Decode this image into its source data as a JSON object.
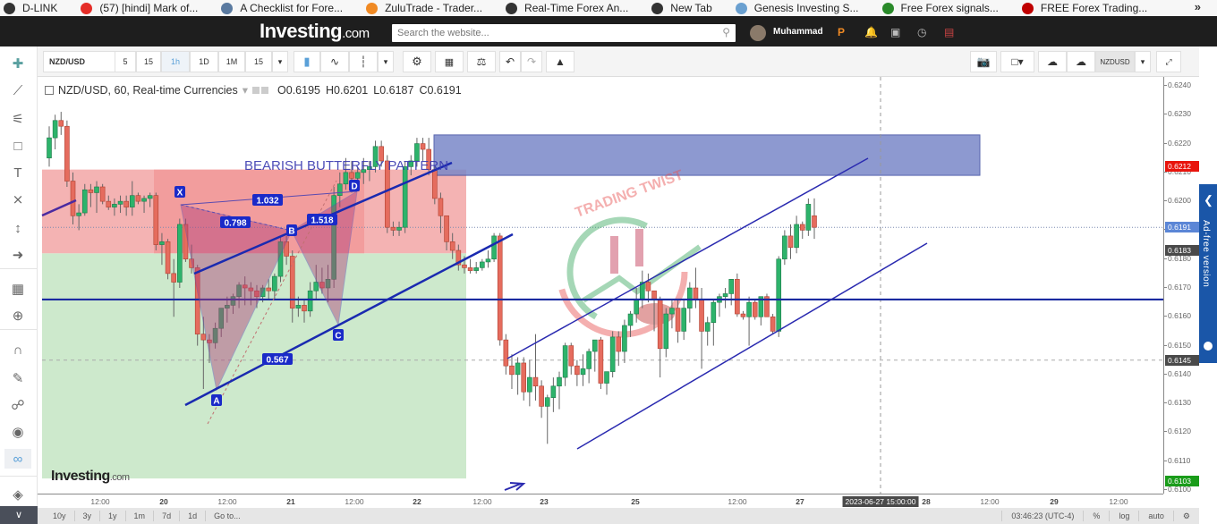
{
  "browser": {
    "bookmarks": [
      {
        "label": "D-LINK",
        "icon": "globe-icon",
        "color": "#333333"
      },
      {
        "label": "(57) [hindi] Mark of...",
        "icon": "youtube-icon",
        "color": "#e52d27"
      },
      {
        "label": "A Checklist for Fore...",
        "icon": "shield-icon",
        "color": "#5a7aa0"
      },
      {
        "label": "ZuluTrade - Trader...",
        "icon": "zulutrade-icon",
        "color": "#f08a24"
      },
      {
        "label": "Real-Time Forex An...",
        "icon": "globe-icon",
        "color": "#333333"
      },
      {
        "label": "New Tab",
        "icon": "globe-icon",
        "color": "#333333"
      },
      {
        "label": "Genesis Investing S...",
        "icon": "genesis-icon",
        "color": "#6aa0d0"
      },
      {
        "label": "Free Forex signals...",
        "icon": "bell-icon",
        "color": "#2a8a2a"
      },
      {
        "label": "FREE Forex Trading...",
        "icon": "bookmark-red-icon",
        "color": "#c00000"
      }
    ],
    "more": "»"
  },
  "site": {
    "logo_main": "Investing",
    "logo_suffix": ".com",
    "search_placeholder": "Search the website...",
    "user_name": "Muhammad"
  },
  "toolbar": {
    "symbol": "NZD/USD",
    "intervals": [
      "5",
      "15",
      "1h",
      "1D",
      "1M",
      "15"
    ],
    "selected_interval": "1h",
    "symbol_compare": "NZDUSD"
  },
  "legend": {
    "title": "NZD/USD, 60, Real-time Currencies",
    "open": "O0.6195",
    "high": "H0.6201",
    "low": "L0.6187",
    "close": "C0.6191"
  },
  "drawing_tools": [
    "crosshair-icon",
    "trend-line-icon",
    "pitchfork-icon",
    "rectangle-icon",
    "text-icon",
    "pattern-icon",
    "measure-icon",
    "back-arrow-icon",
    "indicators-icon",
    "zoom-in-icon",
    "magnet-icon",
    "lock-drawing-icon",
    "unlock-icon",
    "eye-icon",
    "link-icon",
    "layers-icon"
  ],
  "chart_data": {
    "type": "candlestick",
    "symbol": "NZD/USD",
    "interval": "60",
    "ylim": [
      0.61,
      0.624
    ],
    "y_ticks": [
      "0.6240",
      "0.6230",
      "0.6220",
      "0.6210",
      "0.6200",
      "0.6190",
      "0.6180",
      "0.6170",
      "0.6160",
      "0.6150",
      "0.6140",
      "0.6130",
      "0.6120",
      "0.6110",
      "0.6100"
    ],
    "x_ticks": [
      {
        "label": "12:00",
        "bold": false
      },
      {
        "label": "20",
        "bold": true
      },
      {
        "label": "12:00",
        "bold": false
      },
      {
        "label": "21",
        "bold": true
      },
      {
        "label": "12:00",
        "bold": false
      },
      {
        "label": "22",
        "bold": true
      },
      {
        "label": "12:00",
        "bold": false
      },
      {
        "label": "23",
        "bold": true
      },
      {
        "label": "25",
        "bold": true
      },
      {
        "label": "12:00",
        "bold": false
      },
      {
        "label": "27",
        "bold": true
      },
      {
        "label": "28",
        "bold": true
      },
      {
        "label": "12:00",
        "bold": false
      },
      {
        "label": "29",
        "bold": true
      },
      {
        "label": "12:00",
        "bold": false
      }
    ],
    "crosshair_time": "2023-06-27 15:00:00",
    "price_tags": [
      {
        "value": "0.6212",
        "color": "#e8140c"
      },
      {
        "value": "0.6191",
        "color": "#5b86d6"
      },
      {
        "value": "0.6183",
        "color": "#4a4a4a"
      },
      {
        "value": "0.6145",
        "color": "#4a4a4a"
      },
      {
        "value": "0.6103",
        "color": "#1a9c1a"
      }
    ],
    "horizontal_line": 0.6166,
    "candles": [
      [
        0.6215,
        0.6226,
        0.6212,
        0.6222
      ],
      [
        0.6222,
        0.623,
        0.6218,
        0.6228
      ],
      [
        0.6228,
        0.6231,
        0.6223,
        0.6226
      ],
      [
        0.6226,
        0.6228,
        0.6205,
        0.6207
      ],
      [
        0.6207,
        0.621,
        0.6192,
        0.6195
      ],
      [
        0.6195,
        0.6199,
        0.619,
        0.6196
      ],
      [
        0.6196,
        0.6206,
        0.6195,
        0.6204
      ],
      [
        0.6204,
        0.6206,
        0.6198,
        0.6203
      ],
      [
        0.6203,
        0.6207,
        0.6196,
        0.6205
      ],
      [
        0.6205,
        0.6206,
        0.6199,
        0.62
      ],
      [
        0.62,
        0.6202,
        0.6197,
        0.6198
      ],
      [
        0.6198,
        0.6201,
        0.6195,
        0.6199
      ],
      [
        0.6199,
        0.6202,
        0.6196,
        0.62
      ],
      [
        0.62,
        0.6202,
        0.6195,
        0.6198
      ],
      [
        0.6198,
        0.6207,
        0.6195,
        0.6202
      ],
      [
        0.6202,
        0.6203,
        0.6199,
        0.62
      ],
      [
        0.62,
        0.6202,
        0.6196,
        0.6201
      ],
      [
        0.6201,
        0.6203,
        0.6198,
        0.6202
      ],
      [
        0.6202,
        0.6203,
        0.6183,
        0.6185
      ],
      [
        0.6185,
        0.6189,
        0.6178,
        0.6186
      ],
      [
        0.6186,
        0.6187,
        0.6173,
        0.6175
      ],
      [
        0.6175,
        0.618,
        0.616,
        0.6172
      ],
      [
        0.6172,
        0.6194,
        0.617,
        0.6192
      ],
      [
        0.6192,
        0.6194,
        0.6179,
        0.618
      ],
      [
        0.618,
        0.6185,
        0.6175,
        0.6177
      ],
      [
        0.6177,
        0.6178,
        0.615,
        0.6154
      ],
      [
        0.6154,
        0.616,
        0.6135,
        0.6152
      ],
      [
        0.6152,
        0.6154,
        0.6144,
        0.6151
      ],
      [
        0.6151,
        0.6158,
        0.6149,
        0.6156
      ],
      [
        0.6156,
        0.6163,
        0.6153,
        0.6163
      ],
      [
        0.6163,
        0.6167,
        0.6158,
        0.6164
      ],
      [
        0.6164,
        0.6168,
        0.6161,
        0.6167
      ],
      [
        0.6167,
        0.6172,
        0.6163,
        0.6171
      ],
      [
        0.6171,
        0.6174,
        0.6164,
        0.617
      ],
      [
        0.617,
        0.6172,
        0.6164,
        0.6169
      ],
      [
        0.6169,
        0.6171,
        0.6163,
        0.6167
      ],
      [
        0.6167,
        0.6171,
        0.6165,
        0.617
      ],
      [
        0.617,
        0.6173,
        0.6166,
        0.6169
      ],
      [
        0.6169,
        0.6175,
        0.6166,
        0.6174
      ],
      [
        0.6174,
        0.6188,
        0.6172,
        0.6186
      ],
      [
        0.6186,
        0.6188,
        0.6178,
        0.6181
      ],
      [
        0.6181,
        0.6183,
        0.6158,
        0.6163
      ],
      [
        0.6163,
        0.6167,
        0.616,
        0.6164
      ],
      [
        0.6164,
        0.6166,
        0.6158,
        0.6162
      ],
      [
        0.6162,
        0.6172,
        0.616,
        0.6169
      ],
      [
        0.6169,
        0.6178,
        0.6166,
        0.6172
      ],
      [
        0.6172,
        0.6177,
        0.6168,
        0.617
      ],
      [
        0.617,
        0.6178,
        0.6165,
        0.6173
      ],
      [
        0.6173,
        0.6205,
        0.617,
        0.6202
      ],
      [
        0.6202,
        0.621,
        0.6198,
        0.6206
      ],
      [
        0.6206,
        0.6215,
        0.6204,
        0.621
      ],
      [
        0.621,
        0.6214,
        0.6203,
        0.6208
      ],
      [
        0.6208,
        0.6212,
        0.6205,
        0.621
      ],
      [
        0.621,
        0.6215,
        0.6206,
        0.6211
      ],
      [
        0.6211,
        0.6214,
        0.6207,
        0.6212
      ],
      [
        0.6212,
        0.6221,
        0.621,
        0.6219
      ],
      [
        0.6219,
        0.6221,
        0.6212,
        0.6214
      ],
      [
        0.6214,
        0.6216,
        0.6189,
        0.6191
      ],
      [
        0.6191,
        0.6193,
        0.6188,
        0.619
      ],
      [
        0.619,
        0.6193,
        0.6188,
        0.6191
      ],
      [
        0.6191,
        0.6214,
        0.6189,
        0.6212
      ],
      [
        0.6212,
        0.6216,
        0.6209,
        0.6214
      ],
      [
        0.6214,
        0.6222,
        0.6212,
        0.622
      ],
      [
        0.622,
        0.6222,
        0.6214,
        0.6218
      ],
      [
        0.6218,
        0.6222,
        0.6209,
        0.6211
      ],
      [
        0.6211,
        0.6212,
        0.6199,
        0.6201
      ],
      [
        0.6201,
        0.6203,
        0.6189,
        0.6195
      ],
      [
        0.6195,
        0.6195,
        0.6183,
        0.6186
      ],
      [
        0.6186,
        0.6189,
        0.618,
        0.6183
      ],
      [
        0.6183,
        0.6185,
        0.6176,
        0.6178
      ],
      [
        0.6178,
        0.6181,
        0.6175,
        0.6177
      ],
      [
        0.6177,
        0.618,
        0.6175,
        0.6176
      ],
      [
        0.6176,
        0.6179,
        0.6175,
        0.6177
      ],
      [
        0.6177,
        0.618,
        0.6176,
        0.6179
      ],
      [
        0.6179,
        0.6183,
        0.6177,
        0.618
      ],
      [
        0.618,
        0.6189,
        0.6179,
        0.6188
      ],
      [
        0.6188,
        0.6189,
        0.615,
        0.6152
      ],
      [
        0.6152,
        0.6154,
        0.614,
        0.6143
      ],
      [
        0.6143,
        0.6147,
        0.6135,
        0.614
      ],
      [
        0.614,
        0.6146,
        0.6133,
        0.6144
      ],
      [
        0.6144,
        0.6146,
        0.6131,
        0.6134
      ],
      [
        0.6134,
        0.6145,
        0.6129,
        0.6139
      ],
      [
        0.6139,
        0.6154,
        0.6131,
        0.6136
      ],
      [
        0.6136,
        0.6138,
        0.6125,
        0.6129
      ],
      [
        0.6129,
        0.6133,
        0.6116,
        0.6132
      ],
      [
        0.6132,
        0.6139,
        0.6127,
        0.6136
      ],
      [
        0.6136,
        0.6141,
        0.6128,
        0.6139
      ],
      [
        0.6139,
        0.6151,
        0.6136,
        0.615
      ],
      [
        0.615,
        0.6151,
        0.614,
        0.6143
      ],
      [
        0.6143,
        0.6145,
        0.6136,
        0.614
      ],
      [
        0.614,
        0.6147,
        0.6136,
        0.6142
      ],
      [
        0.6142,
        0.6149,
        0.6137,
        0.6148
      ],
      [
        0.6148,
        0.6152,
        0.6141,
        0.6152
      ],
      [
        0.6152,
        0.6153,
        0.6135,
        0.6137
      ],
      [
        0.6137,
        0.6141,
        0.6133,
        0.6141
      ],
      [
        0.6141,
        0.6155,
        0.6139,
        0.6153
      ],
      [
        0.6153,
        0.6155,
        0.6143,
        0.6148
      ],
      [
        0.6148,
        0.6159,
        0.6144,
        0.6157
      ],
      [
        0.6157,
        0.6162,
        0.6153,
        0.6161
      ],
      [
        0.6161,
        0.617,
        0.6158,
        0.6166
      ],
      [
        0.6166,
        0.6176,
        0.6163,
        0.6172
      ],
      [
        0.6172,
        0.6175,
        0.6165,
        0.6169
      ],
      [
        0.6169,
        0.6168,
        0.6155,
        0.6166
      ],
      [
        0.6166,
        0.6167,
        0.6139,
        0.6149
      ],
      [
        0.6149,
        0.6163,
        0.6146,
        0.6161
      ],
      [
        0.6161,
        0.6166,
        0.6156,
        0.6163
      ],
      [
        0.6163,
        0.6166,
        0.6151,
        0.6155
      ],
      [
        0.6155,
        0.6166,
        0.6152,
        0.6163
      ],
      [
        0.6163,
        0.6172,
        0.6158,
        0.617
      ],
      [
        0.617,
        0.6177,
        0.6163,
        0.6166
      ],
      [
        0.6166,
        0.617,
        0.6142,
        0.6155
      ],
      [
        0.6155,
        0.616,
        0.615,
        0.6158
      ],
      [
        0.6158,
        0.6166,
        0.615,
        0.6165
      ],
      [
        0.6165,
        0.6168,
        0.616,
        0.6167
      ],
      [
        0.6167,
        0.617,
        0.6163,
        0.6168
      ],
      [
        0.6168,
        0.6173,
        0.6164,
        0.6173
      ],
      [
        0.6173,
        0.6175,
        0.616,
        0.6161
      ],
      [
        0.6161,
        0.6162,
        0.6159,
        0.616
      ],
      [
        0.616,
        0.6167,
        0.615,
        0.6165
      ],
      [
        0.6165,
        0.6166,
        0.6159,
        0.616
      ],
      [
        0.616,
        0.6167,
        0.6157,
        0.6167
      ],
      [
        0.6167,
        0.6168,
        0.6163,
        0.616
      ],
      [
        0.616,
        0.6161,
        0.6154,
        0.6155
      ],
      [
        0.6155,
        0.6181,
        0.6153,
        0.618
      ],
      [
        0.618,
        0.619,
        0.6178,
        0.6188
      ],
      [
        0.6188,
        0.6192,
        0.618,
        0.6184
      ],
      [
        0.6184,
        0.6195,
        0.6182,
        0.6192
      ],
      [
        0.6192,
        0.6193,
        0.6187,
        0.619
      ],
      [
        0.619,
        0.6201,
        0.6188,
        0.6199
      ],
      [
        0.6195,
        0.6201,
        0.6187,
        0.6191
      ]
    ],
    "zones": [
      {
        "name": "sell-zone",
        "from": 0.621,
        "to": 0.6223,
        "color": "#7a88c8"
      },
      {
        "name": "stop-zone",
        "from": 0.6182,
        "to": 0.6211,
        "color": "#f4b3b3"
      },
      {
        "name": "target-zone",
        "from": 0.6104,
        "to": 0.6182,
        "color": "#cde9cc"
      }
    ],
    "pattern": {
      "title": "BEARISH BUTTERFLY PATTERN",
      "points": [
        "X",
        "A",
        "B",
        "C",
        "D"
      ],
      "ratios": [
        "1.032",
        "0.798",
        "1.518",
        "0.567"
      ]
    }
  },
  "status_bar": {
    "ranges": [
      "10y",
      "3y",
      "1y",
      "1m",
      "7d",
      "1d",
      "Go to..."
    ],
    "clock": "03:46:23 (UTC-4)",
    "percent": "%",
    "log": "log",
    "auto": "auto"
  },
  "ad_tab": {
    "label": "Ad-free version"
  },
  "watermark": {
    "main": "Investing",
    "suffix": ".com"
  }
}
